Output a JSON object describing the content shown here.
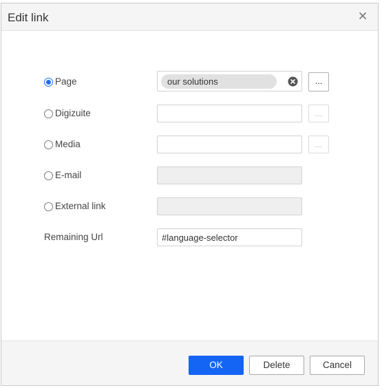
{
  "dialog": {
    "title": "Edit link",
    "close_icon": "close-icon"
  },
  "options": [
    {
      "id": "page",
      "label": "Page",
      "selected": true,
      "value_tag": "our solutions",
      "has_browse": true
    },
    {
      "id": "digizuite",
      "label": "Digizuite",
      "selected": false,
      "value": "",
      "has_browse": true
    },
    {
      "id": "media",
      "label": "Media",
      "selected": false,
      "value": "",
      "has_browse": true
    },
    {
      "id": "email",
      "label": "E-mail",
      "selected": false,
      "value": "",
      "disabled": true
    },
    {
      "id": "external",
      "label": "External link",
      "selected": false,
      "value": "",
      "disabled": true
    }
  ],
  "remaining_url": {
    "label": "Remaining Url",
    "value": "#language-selector"
  },
  "browse_label": "...",
  "buttons": {
    "ok": "OK",
    "delete": "Delete",
    "cancel": "Cancel"
  },
  "colors": {
    "primary": "#1565f5",
    "radio_selected": "#1a73e8",
    "disabled_field": "#efefef"
  }
}
